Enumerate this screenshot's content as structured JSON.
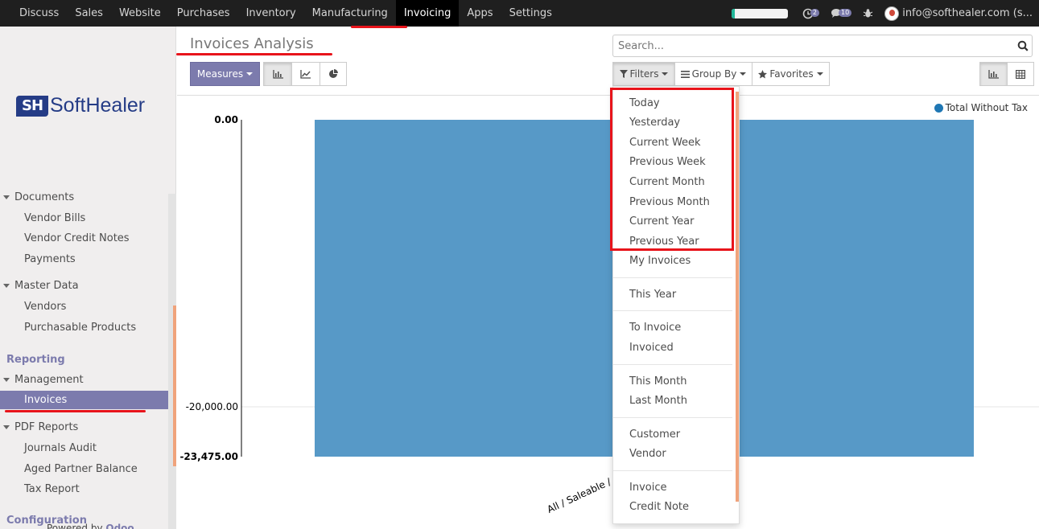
{
  "topnav": {
    "items": [
      "Discuss",
      "Sales",
      "Website",
      "Purchases",
      "Inventory",
      "Manufacturing",
      "Invoicing",
      "Apps",
      "Settings"
    ],
    "active": "Invoicing",
    "activity_badge": "2",
    "messages_badge": "10",
    "user": "info@softhealer.com (s...",
    "progress_fraction": 0.06
  },
  "sidebar": {
    "logo_mark": "SH",
    "logo_text": "SoftHealer",
    "documents": "Documents",
    "vendor_bills": "Vendor Bills",
    "vendor_credit_notes": "Vendor Credit Notes",
    "payments": "Payments",
    "master_data": "Master Data",
    "vendors": "Vendors",
    "purchasable_products": "Purchasable Products",
    "reporting": "Reporting",
    "management": "Management",
    "invoices": "Invoices",
    "pdf_reports": "PDF Reports",
    "journals_audit": "Journals Audit",
    "aged_partner_balance": "Aged Partner Balance",
    "tax_report": "Tax Report",
    "configuration": "Configuration",
    "powered_by": "Powered by",
    "odoo": "Odoo"
  },
  "header": {
    "title": "Invoices Analysis",
    "measures": "Measures",
    "search_placeholder": "Search...",
    "filters": "Filters",
    "group_by": "Group By",
    "favorites": "Favorites"
  },
  "filters_menu": {
    "items": [
      "Today",
      "Yesterday",
      "Current Week",
      "Previous Week",
      "Current Month",
      "Previous Month",
      "Current Year",
      "Previous Year",
      "My Invoices",
      "This Year",
      "To Invoice",
      "Invoiced",
      "This Month",
      "Last Month",
      "Customer",
      "Vendor",
      "Invoice",
      "Credit Note"
    ]
  },
  "colors": {
    "navbar": "#1f1f1f",
    "accent": "#7c7bad",
    "bar": "#5799c7",
    "highlight": "#e8141b"
  },
  "chart_data": {
    "type": "bar",
    "categories": [
      "All / Saleable /"
    ],
    "series": [
      {
        "name": "Total Without Tax",
        "values": [
          -23475
        ]
      }
    ],
    "ylim": [
      -23475,
      0
    ],
    "y_ticks": [
      "0.00",
      "-20,000.00",
      "-23,475.00"
    ],
    "legend": "top-right",
    "grid": true
  }
}
